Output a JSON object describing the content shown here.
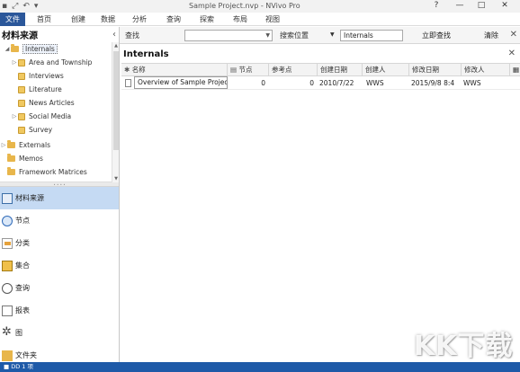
{
  "window": {
    "title": "Sample Project.nvp - NVivo Pro",
    "controls": [
      "?",
      "—",
      "□",
      "✕"
    ]
  },
  "quick_access": [
    "▪",
    "⤢",
    "↶",
    "▾"
  ],
  "ribbon_tabs": [
    "文件",
    "首页",
    "创建",
    "数据",
    "分析",
    "查询",
    "探索",
    "布局",
    "视图"
  ],
  "left_panel": {
    "title": "材料来源",
    "collapse_glyph": "‹",
    "tree": [
      {
        "label": "Internals",
        "arrow": "◢",
        "selected": true
      },
      {
        "label": "Area and Township",
        "arrow": "▷"
      },
      {
        "label": "Interviews",
        "arrow": ""
      },
      {
        "label": "Literature",
        "arrow": ""
      },
      {
        "label": "News Articles",
        "arrow": ""
      },
      {
        "label": "Social Media",
        "arrow": "▷"
      },
      {
        "label": "Survey",
        "arrow": ""
      },
      {
        "label": "Externals",
        "arrow": "▷"
      },
      {
        "label": "Memos",
        "arrow": ""
      },
      {
        "label": "Framework Matrices",
        "arrow": ""
      }
    ],
    "nav": [
      {
        "label": "材料来源",
        "icon": "sources-icon"
      },
      {
        "label": "节点",
        "icon": "nodes-icon"
      },
      {
        "label": "分类",
        "icon": "classifications-icon"
      },
      {
        "label": "集合",
        "icon": "collections-icon"
      },
      {
        "label": "查询",
        "icon": "queries-icon"
      },
      {
        "label": "报表",
        "icon": "reports-icon"
      },
      {
        "label": "图",
        "icon": "maps-icon"
      },
      {
        "label": "文件夹",
        "icon": "folders-icon"
      }
    ]
  },
  "find_bar": {
    "look_for_label": "查找",
    "search_in_label": "搜索位置",
    "search_in_value": "Internals",
    "find_now": "立即查找",
    "clear": "清除",
    "close": "✕"
  },
  "content": {
    "title": "Internals",
    "close": "✕",
    "columns": [
      "名称",
      "节点",
      "参考点",
      "创建日期",
      "创建人",
      "修改日期",
      "修改人"
    ],
    "rows": [
      {
        "name": "Overview of Sample Projec",
        "nodes": "0",
        "references": "0",
        "created_on": "2010/7/22",
        "created_by": "WWS",
        "modified_on": "2015/9/8 8:4",
        "modified_by": "WWS"
      }
    ]
  },
  "status_bar": {
    "text": "■ DD   1 项"
  },
  "watermark": "KK下载"
}
